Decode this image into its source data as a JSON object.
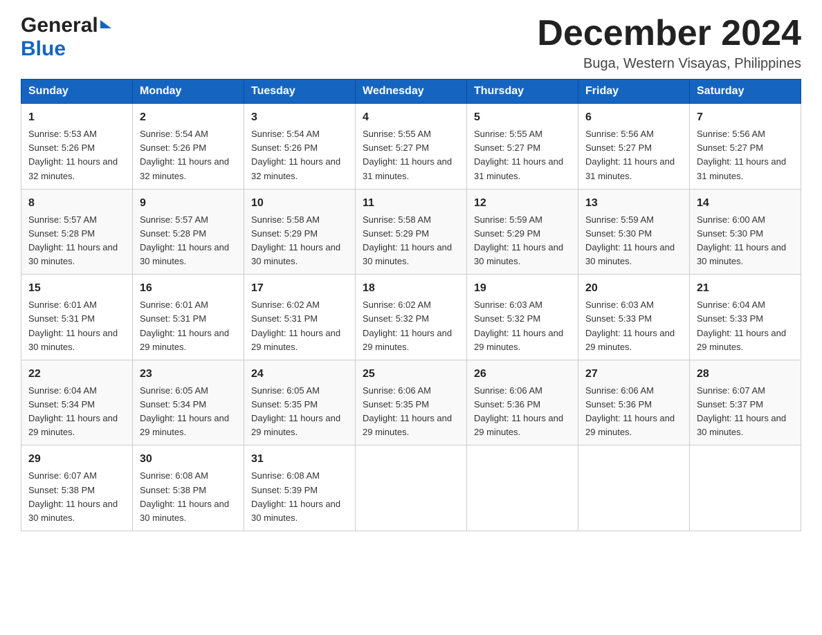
{
  "header": {
    "month_title": "December 2024",
    "location": "Buga, Western Visayas, Philippines",
    "logo_general": "General",
    "logo_blue": "Blue"
  },
  "weekdays": [
    "Sunday",
    "Monday",
    "Tuesday",
    "Wednesday",
    "Thursday",
    "Friday",
    "Saturday"
  ],
  "weeks": [
    [
      {
        "day": "1",
        "sunrise": "5:53 AM",
        "sunset": "5:26 PM",
        "daylight": "11 hours and 32 minutes."
      },
      {
        "day": "2",
        "sunrise": "5:54 AM",
        "sunset": "5:26 PM",
        "daylight": "11 hours and 32 minutes."
      },
      {
        "day": "3",
        "sunrise": "5:54 AM",
        "sunset": "5:26 PM",
        "daylight": "11 hours and 32 minutes."
      },
      {
        "day": "4",
        "sunrise": "5:55 AM",
        "sunset": "5:27 PM",
        "daylight": "11 hours and 31 minutes."
      },
      {
        "day": "5",
        "sunrise": "5:55 AM",
        "sunset": "5:27 PM",
        "daylight": "11 hours and 31 minutes."
      },
      {
        "day": "6",
        "sunrise": "5:56 AM",
        "sunset": "5:27 PM",
        "daylight": "11 hours and 31 minutes."
      },
      {
        "day": "7",
        "sunrise": "5:56 AM",
        "sunset": "5:27 PM",
        "daylight": "11 hours and 31 minutes."
      }
    ],
    [
      {
        "day": "8",
        "sunrise": "5:57 AM",
        "sunset": "5:28 PM",
        "daylight": "11 hours and 30 minutes."
      },
      {
        "day": "9",
        "sunrise": "5:57 AM",
        "sunset": "5:28 PM",
        "daylight": "11 hours and 30 minutes."
      },
      {
        "day": "10",
        "sunrise": "5:58 AM",
        "sunset": "5:29 PM",
        "daylight": "11 hours and 30 minutes."
      },
      {
        "day": "11",
        "sunrise": "5:58 AM",
        "sunset": "5:29 PM",
        "daylight": "11 hours and 30 minutes."
      },
      {
        "day": "12",
        "sunrise": "5:59 AM",
        "sunset": "5:29 PM",
        "daylight": "11 hours and 30 minutes."
      },
      {
        "day": "13",
        "sunrise": "5:59 AM",
        "sunset": "5:30 PM",
        "daylight": "11 hours and 30 minutes."
      },
      {
        "day": "14",
        "sunrise": "6:00 AM",
        "sunset": "5:30 PM",
        "daylight": "11 hours and 30 minutes."
      }
    ],
    [
      {
        "day": "15",
        "sunrise": "6:01 AM",
        "sunset": "5:31 PM",
        "daylight": "11 hours and 30 minutes."
      },
      {
        "day": "16",
        "sunrise": "6:01 AM",
        "sunset": "5:31 PM",
        "daylight": "11 hours and 29 minutes."
      },
      {
        "day": "17",
        "sunrise": "6:02 AM",
        "sunset": "5:31 PM",
        "daylight": "11 hours and 29 minutes."
      },
      {
        "day": "18",
        "sunrise": "6:02 AM",
        "sunset": "5:32 PM",
        "daylight": "11 hours and 29 minutes."
      },
      {
        "day": "19",
        "sunrise": "6:03 AM",
        "sunset": "5:32 PM",
        "daylight": "11 hours and 29 minutes."
      },
      {
        "day": "20",
        "sunrise": "6:03 AM",
        "sunset": "5:33 PM",
        "daylight": "11 hours and 29 minutes."
      },
      {
        "day": "21",
        "sunrise": "6:04 AM",
        "sunset": "5:33 PM",
        "daylight": "11 hours and 29 minutes."
      }
    ],
    [
      {
        "day": "22",
        "sunrise": "6:04 AM",
        "sunset": "5:34 PM",
        "daylight": "11 hours and 29 minutes."
      },
      {
        "day": "23",
        "sunrise": "6:05 AM",
        "sunset": "5:34 PM",
        "daylight": "11 hours and 29 minutes."
      },
      {
        "day": "24",
        "sunrise": "6:05 AM",
        "sunset": "5:35 PM",
        "daylight": "11 hours and 29 minutes."
      },
      {
        "day": "25",
        "sunrise": "6:06 AM",
        "sunset": "5:35 PM",
        "daylight": "11 hours and 29 minutes."
      },
      {
        "day": "26",
        "sunrise": "6:06 AM",
        "sunset": "5:36 PM",
        "daylight": "11 hours and 29 minutes."
      },
      {
        "day": "27",
        "sunrise": "6:06 AM",
        "sunset": "5:36 PM",
        "daylight": "11 hours and 29 minutes."
      },
      {
        "day": "28",
        "sunrise": "6:07 AM",
        "sunset": "5:37 PM",
        "daylight": "11 hours and 30 minutes."
      }
    ],
    [
      {
        "day": "29",
        "sunrise": "6:07 AM",
        "sunset": "5:38 PM",
        "daylight": "11 hours and 30 minutes."
      },
      {
        "day": "30",
        "sunrise": "6:08 AM",
        "sunset": "5:38 PM",
        "daylight": "11 hours and 30 minutes."
      },
      {
        "day": "31",
        "sunrise": "6:08 AM",
        "sunset": "5:39 PM",
        "daylight": "11 hours and 30 minutes."
      },
      null,
      null,
      null,
      null
    ]
  ],
  "labels": {
    "sunrise": "Sunrise:",
    "sunset": "Sunset:",
    "daylight": "Daylight:"
  }
}
